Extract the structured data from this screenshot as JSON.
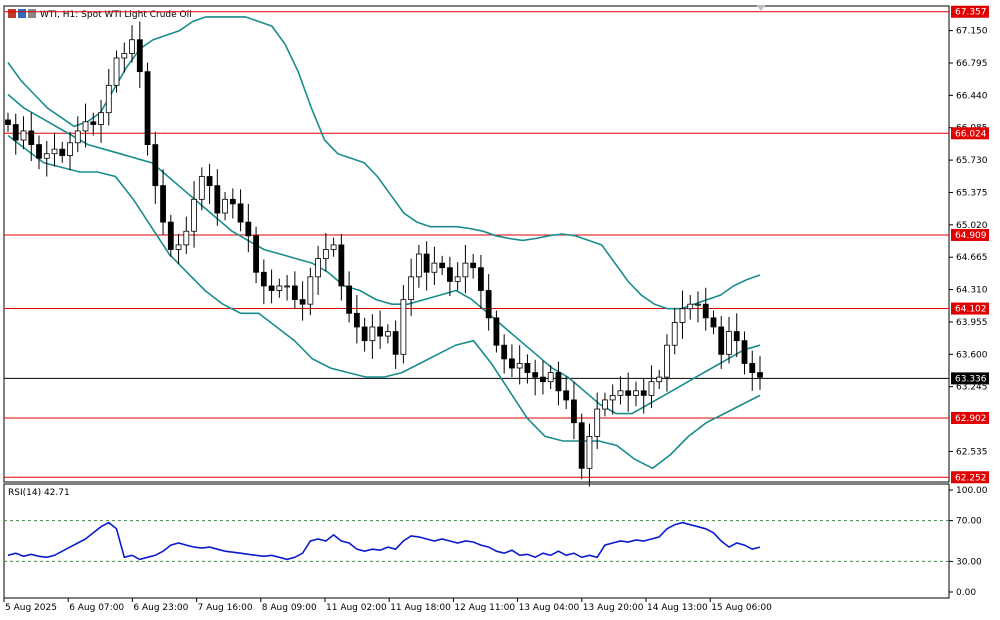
{
  "header": {
    "title": "WTI, H1:  Spot WTI Light Crude Oil"
  },
  "colors": {
    "candle": "#000000",
    "bands": "#1a8c8c",
    "level_line": "#e00000",
    "level_label_bg": "#e00000",
    "price_line": "#000000",
    "price_label_bg": "#000000",
    "rsi_line": "#0a1ccc",
    "grid_dash": "#3c8c3c"
  },
  "chart_data": [
    {
      "type": "candlestick",
      "title": "WTI, H1:  Spot WTI Light Crude Oil",
      "y_ticks": [
        "67.150",
        "66.795",
        "66.440",
        "66.085",
        "65.730",
        "65.375",
        "65.020",
        "64.665",
        "64.310",
        "63.955",
        "63.600",
        "63.245",
        "62.535"
      ],
      "ylim": [
        62.2,
        67.42
      ],
      "x_ticks": [
        "5 Aug 2025",
        "6 Aug 07:00",
        "6 Aug 23:00",
        "7 Aug 16:00",
        "8 Aug 09:00",
        "11 Aug 02:00",
        "11 Aug 18:00",
        "12 Aug 11:00",
        "13 Aug 04:00",
        "13 Aug 20:00",
        "14 Aug 13:00",
        "15 Aug 06:00"
      ],
      "horizontal_levels": [
        "67.357",
        "66.024",
        "64.909",
        "64.102",
        "62.902",
        "62.252"
      ],
      "current_price": "63.336",
      "series": [
        {
          "name": "price",
          "close": [
            66.12,
            65.95,
            66.05,
            65.9,
            65.75,
            65.8,
            65.85,
            65.78,
            65.92,
            66.05,
            66.15,
            66.12,
            66.25,
            66.55,
            66.85,
            66.9,
            67.05,
            66.7,
            65.9,
            65.45,
            65.05,
            64.75,
            64.8,
            64.95,
            65.3,
            65.55,
            65.45,
            65.15,
            65.3,
            65.25,
            65.05,
            64.9,
            64.5,
            64.35,
            64.3,
            64.35,
            64.35,
            64.2,
            64.15,
            64.45,
            64.65,
            64.75,
            64.8,
            64.35,
            64.05,
            63.9,
            63.75,
            63.9,
            63.8,
            63.85,
            63.6,
            64.2,
            64.45,
            64.7,
            64.5,
            64.6,
            64.55,
            64.4,
            64.45,
            64.6,
            64.55,
            64.3,
            64.0,
            63.7,
            63.55,
            63.45,
            63.5,
            63.4,
            63.35,
            63.3,
            63.4,
            63.2,
            63.1,
            62.85,
            62.35,
            62.7,
            63.0,
            63.1,
            63.15,
            63.2,
            63.15,
            63.2,
            63.15,
            63.3,
            63.35,
            63.7,
            63.95,
            64.1,
            64.15,
            64.15,
            64.0,
            63.9,
            63.6,
            63.85,
            63.75,
            63.5,
            63.4,
            63.35
          ],
          "yticks_visible": true
        },
        {
          "name": "bollinger_upper",
          "values": [
            66.8,
            66.6,
            66.45,
            66.3,
            66.2,
            66.1,
            66.15,
            66.25,
            66.5,
            66.75,
            66.95,
            67.05,
            67.1,
            67.15,
            67.25,
            67.3,
            67.3,
            67.3,
            67.3,
            67.25,
            67.2,
            67.0,
            66.7,
            66.3,
            65.95,
            65.8,
            65.75,
            65.7,
            65.55,
            65.35,
            65.15,
            65.05,
            65.0,
            65.0,
            65.0,
            64.98,
            64.95,
            64.9,
            64.87,
            64.85,
            64.87,
            64.9,
            64.92,
            64.9,
            64.85,
            64.8,
            64.6,
            64.4,
            64.25,
            64.15,
            64.1,
            64.1,
            64.15,
            64.2,
            64.25,
            64.35,
            64.42,
            64.47
          ],
          "yticks_visible": false
        },
        {
          "name": "bollinger_middle",
          "values": [
            66.45,
            66.3,
            66.2,
            66.1,
            66.0,
            65.9,
            65.85,
            65.8,
            65.75,
            65.7,
            65.55,
            65.4,
            65.25,
            65.1,
            64.95,
            64.85,
            64.75,
            64.7,
            64.65,
            64.6,
            64.5,
            64.35,
            64.3,
            64.2,
            64.15,
            64.15,
            64.2,
            64.25,
            64.3,
            64.2,
            64.05,
            63.9,
            63.75,
            63.6,
            63.45,
            63.35,
            63.2,
            63.05,
            62.95,
            62.95,
            63.05,
            63.15,
            63.25,
            63.35,
            63.45,
            63.55,
            63.65,
            63.7
          ],
          "yticks_visible": false
        },
        {
          "name": "bollinger_lower",
          "values": [
            66.0,
            65.85,
            65.7,
            65.65,
            65.6,
            65.6,
            65.55,
            65.3,
            65.0,
            64.7,
            64.5,
            64.3,
            64.15,
            64.05,
            64.05,
            63.9,
            63.75,
            63.55,
            63.45,
            63.4,
            63.35,
            63.35,
            63.4,
            63.5,
            63.6,
            63.7,
            63.75,
            63.5,
            63.2,
            62.9,
            62.7,
            62.65,
            62.65,
            62.65,
            62.6,
            62.45,
            62.35,
            62.5,
            62.7,
            62.85,
            62.95,
            63.05,
            63.15
          ],
          "yticks_visible": false
        }
      ]
    },
    {
      "type": "line",
      "title": "RSI(14) 42.71",
      "y_ticks": [
        "100.00",
        "70.00",
        "30.00",
        "0.00"
      ],
      "ylim": [
        0,
        100
      ],
      "levels": [
        70,
        30
      ],
      "series": [
        {
          "values": [
            36,
            38,
            35,
            37,
            35,
            34,
            36,
            40,
            44,
            48,
            52,
            58,
            64,
            68,
            62,
            34,
            36,
            32,
            34,
            36,
            40,
            46,
            48,
            46,
            44,
            43,
            44,
            42,
            40,
            39,
            38,
            37,
            36,
            35,
            36,
            34,
            32,
            34,
            38,
            50,
            52,
            50,
            56,
            50,
            48,
            42,
            40,
            42,
            41,
            44,
            42,
            50,
            55,
            54,
            52,
            50,
            52,
            50,
            48,
            50,
            49,
            46,
            44,
            40,
            38,
            41,
            36,
            37,
            34,
            38,
            36,
            40,
            36,
            38,
            34,
            36,
            34,
            46,
            48,
            50,
            49,
            51,
            50,
            52,
            54,
            62,
            66,
            68,
            66,
            64,
            62,
            58,
            50,
            44,
            48,
            46,
            42,
            44
          ]
        }
      ]
    }
  ]
}
